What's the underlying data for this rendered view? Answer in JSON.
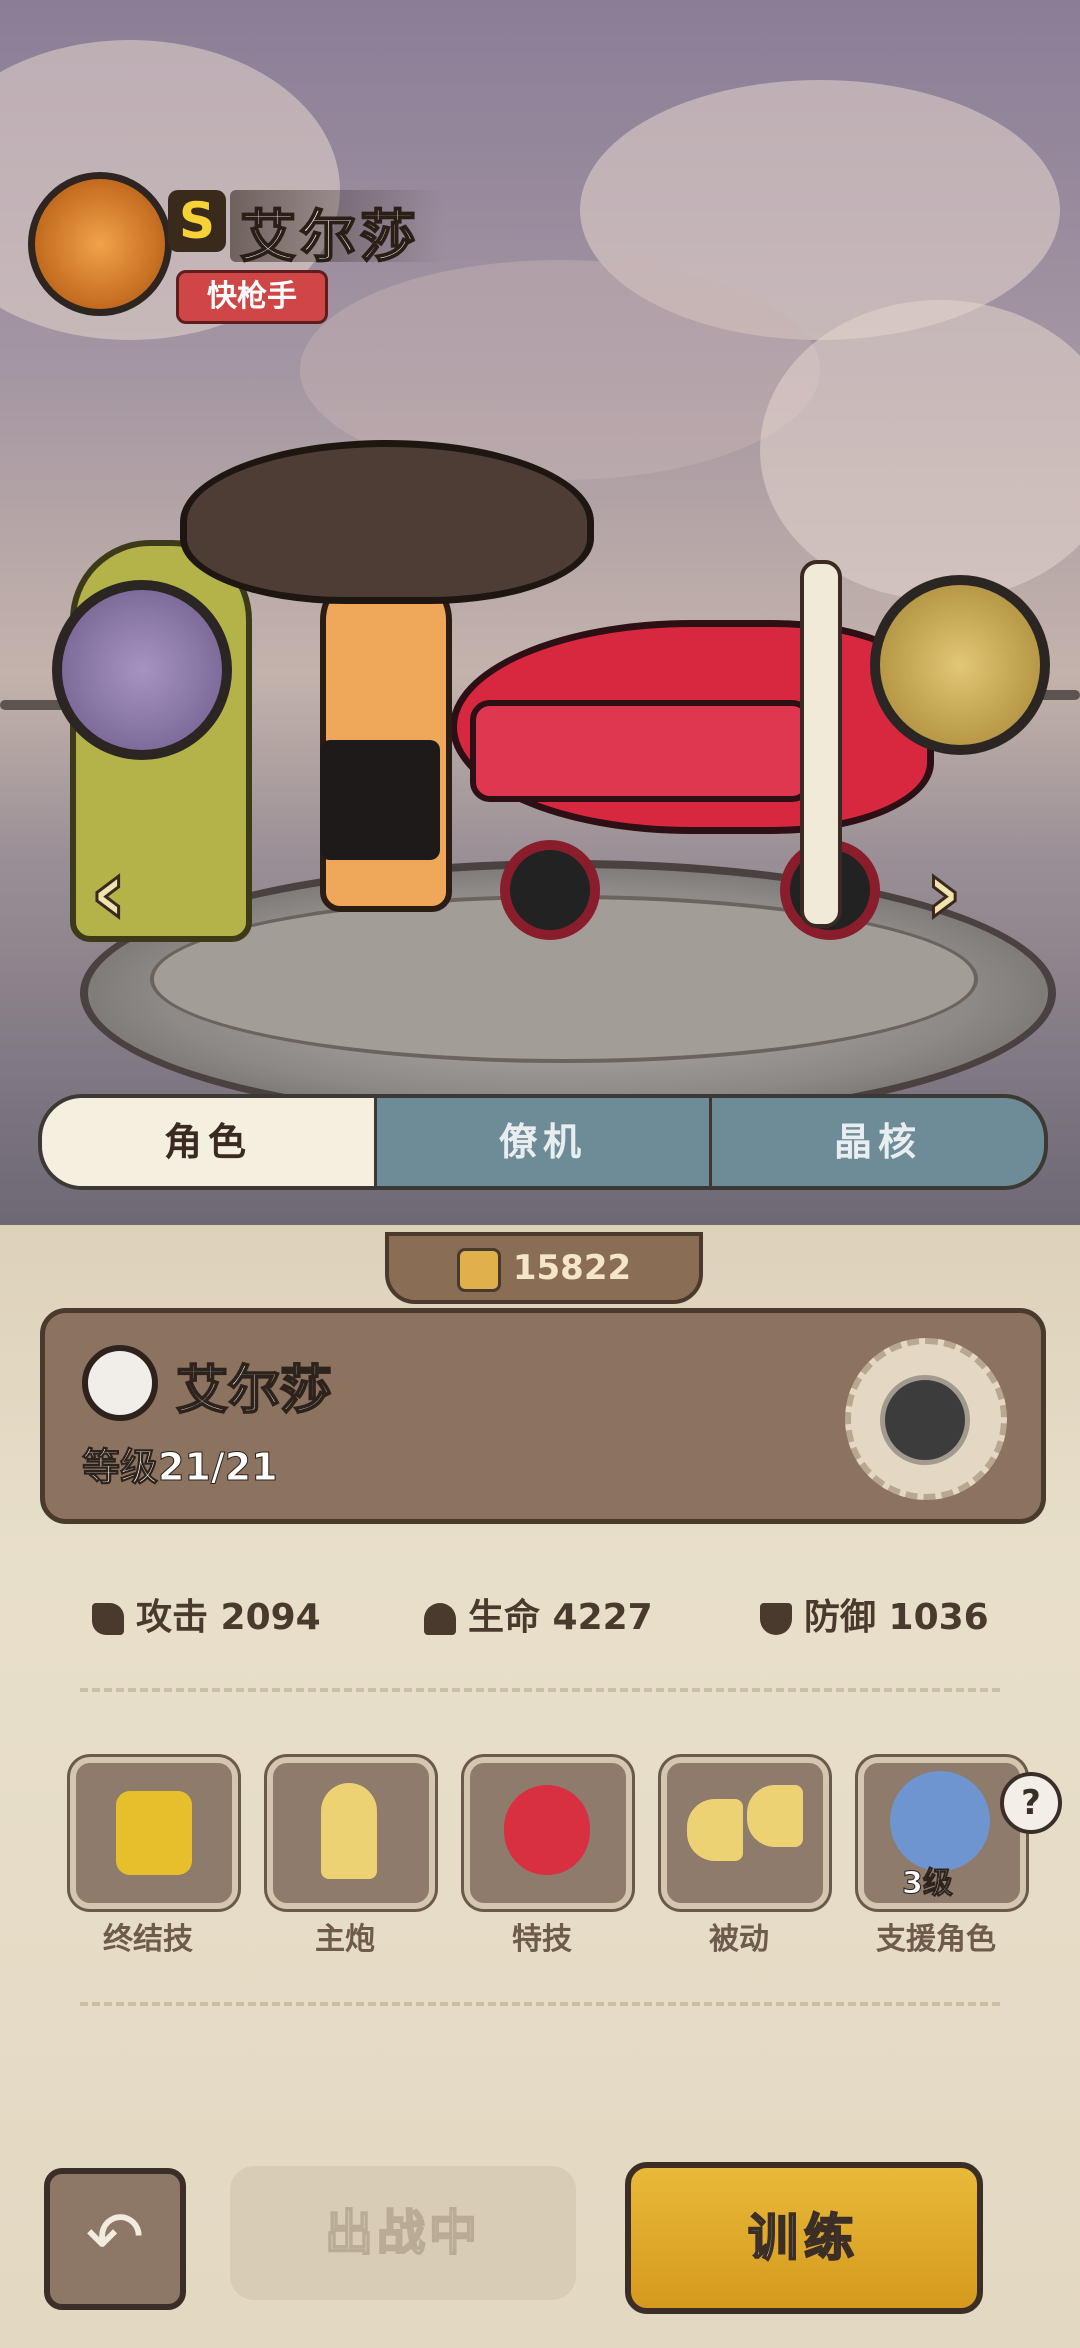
{
  "hero": {
    "rarity": "S",
    "name": "艾尔莎",
    "class": "快枪手"
  },
  "tabs": [
    {
      "label": "角色",
      "active": true
    },
    {
      "label": "僚机",
      "active": false
    },
    {
      "label": "晶核",
      "active": false
    }
  ],
  "power": {
    "value": "15822"
  },
  "info": {
    "name": "艾尔莎",
    "level": "等级21/21"
  },
  "stats": {
    "attack": {
      "label": "攻击 2094"
    },
    "hp": {
      "label": "生命 4227"
    },
    "defense": {
      "label": "防御 1036"
    }
  },
  "skills": [
    {
      "label": "终结技",
      "icon": "gatling-icon"
    },
    {
      "label": "主炮",
      "icon": "bullet-icon"
    },
    {
      "label": "特技",
      "icon": "heart-gem-icon"
    },
    {
      "label": "被动",
      "icon": "double-bullet-icon"
    },
    {
      "label": "支援角色",
      "icon": "support-character-icon",
      "level": "3级"
    }
  ],
  "help": "?",
  "buttons": {
    "back": "↶",
    "deploy": "出战中",
    "train": "训练"
  },
  "nav": {
    "prev": "‹",
    "next": "›"
  },
  "colors": {
    "accent": "#e2ad2d",
    "rarity": "#f6d236",
    "class_badge": "#d04646"
  }
}
